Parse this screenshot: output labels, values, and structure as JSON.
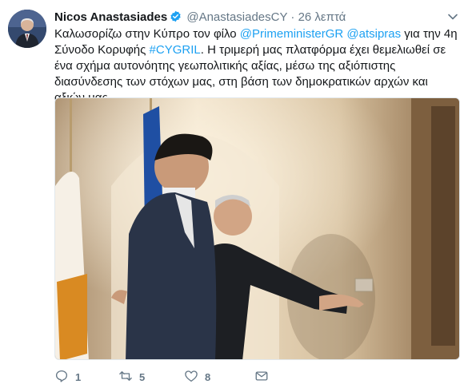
{
  "tweet": {
    "author_name": "Nicos Anastasiades",
    "handle": "@AnastasiadesCY",
    "separator": "·",
    "time": "26 λεπτά",
    "text": {
      "p1": "Καλωσορίζω στην Κύπρο τον φίλο ",
      "mention1": "@PrimeministerGR",
      "p2": " ",
      "mention2": "@atsipras",
      "p3": " για την 4η Σύνοδο Κορυφής ",
      "hashtag": "#CYGRIL",
      "p4": ". Η τριμερή μας πλατφόρμα έχει θεμελιωθεί σε ένα σχήμα αυτονόητης γεωπολιτικής αξίας, μέσω της αξιόπιστης διασύνδεσης των στόχων μας, στη βάση των δημοκρατικών αρχών και αξιών μας."
    },
    "actions": {
      "reply_count": "1",
      "retweet_count": "5",
      "like_count": "8"
    }
  },
  "colors": {
    "link": "#1da1f2",
    "secondary_text": "#657786",
    "verified": "#1da1f2"
  },
  "icons": [
    "avatar",
    "verified-badge-icon",
    "chevron-down-icon",
    "reply-icon",
    "retweet-icon",
    "like-icon",
    "direct-message-icon"
  ]
}
